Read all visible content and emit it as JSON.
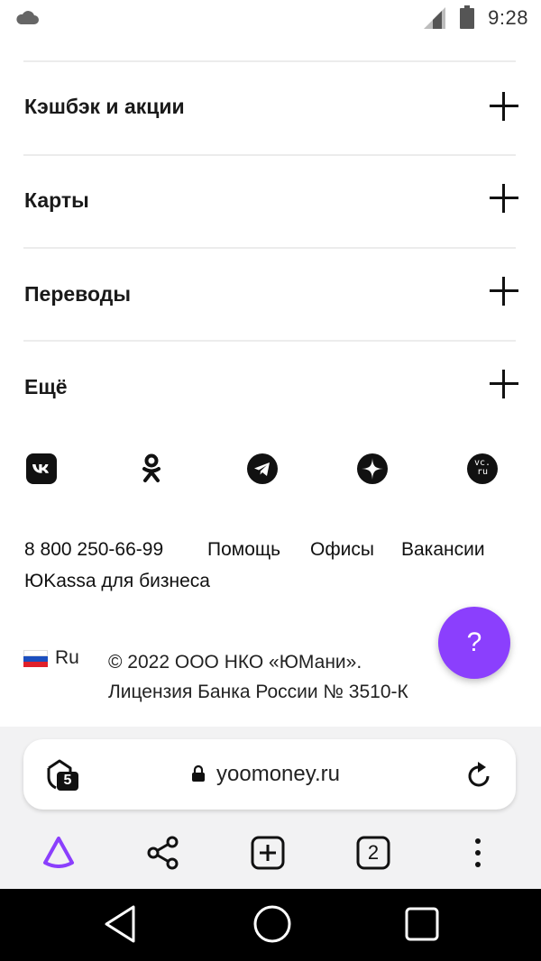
{
  "status_bar": {
    "time": "9:28",
    "icons": [
      "cloud-icon",
      "signal-icon",
      "battery-icon"
    ]
  },
  "accordion": [
    {
      "label": "Кэшбэк и акции"
    },
    {
      "label": "Карты"
    },
    {
      "label": "Переводы"
    },
    {
      "label": "Ещё"
    }
  ],
  "socials": [
    "vk-icon",
    "odnoklassniki-icon",
    "telegram-icon",
    "zen-icon",
    "vc-ru-icon"
  ],
  "vc_label": "vc.ru",
  "footer_links": {
    "phone": "8 800 250-66-99",
    "help": "Помощь",
    "offices": "Офисы",
    "vacancies": "Вакансии",
    "business": "ЮKassa для бизнеса"
  },
  "language": "Ru",
  "copyright_line1": "© 2022 ООО НКО «ЮМани».",
  "copyright_line2": "Лицензия Банка России № 3510-К",
  "help_button": "?",
  "browser": {
    "url": "yoomoney.ru",
    "shield_count": "5",
    "tabs_count": "2"
  },
  "colors": {
    "accent": "#8b3ffd",
    "flag_white": "#ffffff",
    "flag_blue": "#1b4fbf",
    "flag_red": "#e0202a"
  }
}
